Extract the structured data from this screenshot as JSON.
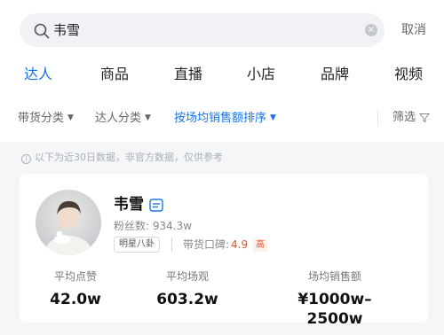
{
  "search": {
    "query": "韦雪",
    "cancel_label": "取消"
  },
  "tabs": [
    {
      "label": "达人",
      "active": true
    },
    {
      "label": "商品",
      "active": false
    },
    {
      "label": "直播",
      "active": false
    },
    {
      "label": "小店",
      "active": false
    },
    {
      "label": "品牌",
      "active": false
    },
    {
      "label": "视频",
      "active": false
    }
  ],
  "filters": {
    "goods_category": "带货分类",
    "talent_category": "达人分类",
    "sort": "按场均销售额排序",
    "screen": "筛选"
  },
  "notice": "以下为近30日数据，非官方数据，仅供参考",
  "talent": {
    "name": "韦雪",
    "fans": "粉丝数: 934.3w",
    "tag": "明星八卦",
    "reputation_label": "带货口碑:",
    "reputation_score": "4.9",
    "reputation_level": "高",
    "stats": [
      {
        "label": "平均点赞",
        "value": "42.0w"
      },
      {
        "label": "平均场观",
        "value": "603.2w"
      },
      {
        "label": "场均销售额",
        "value": "¥1000w–2500w"
      }
    ]
  },
  "colors": {
    "accent": "#1a73e8",
    "score": "#e2542a"
  },
  "icons": {
    "search": "search-icon",
    "clear": "clear-icon",
    "filter": "funnel-icon",
    "badge": "live-badge-icon",
    "info": "info-icon"
  }
}
